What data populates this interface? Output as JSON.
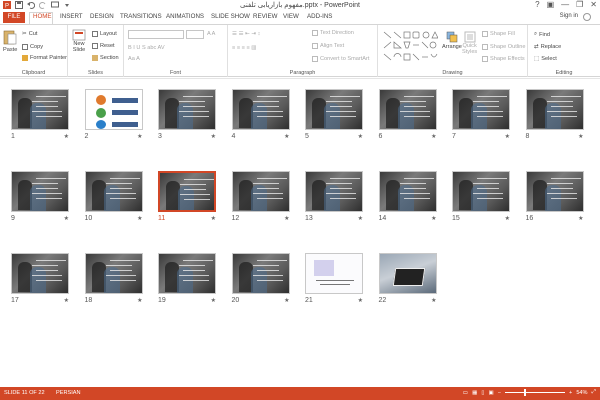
{
  "window": {
    "title": "مفهوم بازاریابی تلفنی.pptx - PowerPoint",
    "help": "?",
    "min": "—",
    "max": "❐",
    "close": "✕"
  },
  "tabs": {
    "file": "FILE",
    "items": [
      "HOME",
      "INSERT",
      "DESIGN",
      "TRANSITIONS",
      "ANIMATIONS",
      "SLIDE SHOW",
      "REVIEW",
      "VIEW",
      "ADD-INS"
    ],
    "signin": "Sign in"
  },
  "ribbon": {
    "clipboard": {
      "label": "Clipboard",
      "paste": "Paste",
      "cut": "Cut",
      "copy": "Copy",
      "format_painter": "Format Painter"
    },
    "slides": {
      "label": "Slides",
      "new_slide": "New",
      "new_slide2": "Slide",
      "layout": "Layout",
      "reset": "Reset",
      "section": "Section"
    },
    "font": {
      "label": "Font",
      "size": ""
    },
    "paragraph": {
      "label": "Paragraph",
      "text_direction": "Text Direction",
      "align_text": "Align Text",
      "convert_smartart": "Convert to SmartArt"
    },
    "drawing": {
      "label": "Drawing",
      "arrange": "Arrange",
      "quick_styles": "Quick",
      "quick_styles2": "Styles",
      "shape_fill": "Shape Fill",
      "shape_outline": "Shape Outline",
      "shape_effects": "Shape Effects"
    },
    "editing": {
      "label": "Editing",
      "find": "Find",
      "replace": "Replace",
      "select": "Select"
    }
  },
  "slides": [
    {
      "num": "1",
      "kind": "dark",
      "selected": false
    },
    {
      "num": "2",
      "kind": "diagram",
      "selected": false
    },
    {
      "num": "3",
      "kind": "dark",
      "selected": false
    },
    {
      "num": "4",
      "kind": "dark",
      "selected": false
    },
    {
      "num": "5",
      "kind": "dark",
      "selected": false
    },
    {
      "num": "6",
      "kind": "dark",
      "selected": false
    },
    {
      "num": "7",
      "kind": "dark",
      "selected": false
    },
    {
      "num": "8",
      "kind": "dark",
      "selected": false
    },
    {
      "num": "9",
      "kind": "dark",
      "selected": false
    },
    {
      "num": "10",
      "kind": "dark",
      "selected": false
    },
    {
      "num": "11",
      "kind": "dark",
      "selected": true
    },
    {
      "num": "12",
      "kind": "dark",
      "selected": false
    },
    {
      "num": "13",
      "kind": "dark",
      "selected": false
    },
    {
      "num": "14",
      "kind": "dark",
      "selected": false
    },
    {
      "num": "15",
      "kind": "dark",
      "selected": false
    },
    {
      "num": "16",
      "kind": "dark",
      "selected": false
    },
    {
      "num": "17",
      "kind": "dark",
      "selected": false
    },
    {
      "num": "18",
      "kind": "dark",
      "selected": false
    },
    {
      "num": "19",
      "kind": "dark",
      "selected": false
    },
    {
      "num": "20",
      "kind": "dark",
      "selected": false
    },
    {
      "num": "21",
      "kind": "white",
      "selected": false
    },
    {
      "num": "22",
      "kind": "laptop",
      "selected": false
    }
  ],
  "star_glyph": "★",
  "status": {
    "slide_info": "SLIDE 11 OF 22",
    "language": "PERSIAN",
    "zoom": "54%",
    "zoom_level_percent": 54,
    "minus": "−",
    "plus": "+"
  },
  "colors": {
    "accent": "#d24726"
  }
}
